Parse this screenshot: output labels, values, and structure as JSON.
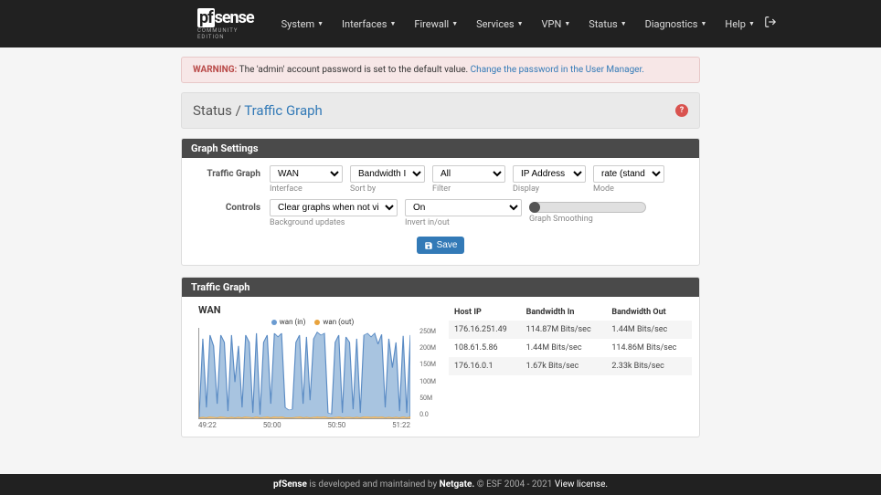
{
  "nav": {
    "items": [
      "System",
      "Interfaces",
      "Firewall",
      "Services",
      "VPN",
      "Status",
      "Diagnostics",
      "Help"
    ]
  },
  "alert": {
    "prefix": "WARNING:",
    "text": " The 'admin' account password is set to the default value. ",
    "link": "Change the password in the User Manager."
  },
  "breadcrumb": {
    "root": "Status",
    "sep": " / ",
    "page": "Traffic Graph"
  },
  "panel1": {
    "title": "Graph Settings",
    "row1_label": "Traffic Graph",
    "row2_label": "Controls",
    "interface": {
      "value": "WAN",
      "hint": "Interface"
    },
    "sort": {
      "value": "Bandwidth In",
      "hint": "Sort by"
    },
    "filter": {
      "value": "All",
      "hint": "Filter"
    },
    "display": {
      "value": "IP Address",
      "hint": "Display"
    },
    "mode": {
      "value": "rate (standard)",
      "hint": "Mode"
    },
    "bg": {
      "value": "Clear graphs when not visible.",
      "hint": "Background updates"
    },
    "invert": {
      "value": "On",
      "hint": "Invert in/out"
    },
    "smooth": {
      "hint": "Graph Smoothing"
    },
    "save": "Save"
  },
  "panel2": {
    "title": "Traffic Graph"
  },
  "chart_data": {
    "type": "area",
    "title": "WAN",
    "legend": [
      "wan (in)",
      "wan (out)"
    ],
    "ylim": [
      0,
      250000000
    ],
    "yticks": [
      "250M",
      "200M",
      "150M",
      "100M",
      "50M",
      "0.0"
    ],
    "xticks": [
      "49:22",
      "50:00",
      "50:50",
      "51:22"
    ],
    "series": [
      {
        "name": "wan (in)",
        "color": "#6b9bd1",
        "values": [
          10,
          220,
          30,
          230,
          200,
          40,
          230,
          210,
          20,
          230,
          100,
          200,
          30,
          230,
          210,
          15,
          235,
          10,
          210,
          230,
          40,
          235,
          225,
          235,
          30,
          23,
          25,
          210,
          230,
          40,
          225,
          50,
          220,
          238,
          230,
          235,
          15,
          12,
          210,
          230,
          15,
          225,
          210,
          25,
          220,
          15,
          230,
          235,
          225,
          235,
          205,
          232,
          30,
          220,
          140,
          210,
          20,
          228,
          15,
          230
        ]
      },
      {
        "name": "wan (out)",
        "color": "#e8a33d",
        "values": [
          2,
          3,
          2,
          4,
          3,
          2,
          4,
          3,
          2,
          3,
          2,
          3,
          2,
          4,
          3,
          2,
          4,
          2,
          3,
          4,
          2,
          4,
          3,
          4,
          2,
          2,
          2,
          3,
          4,
          2,
          3,
          2,
          3,
          4,
          3,
          4,
          2,
          2,
          3,
          4,
          2,
          3,
          3,
          2,
          3,
          2,
          4,
          4,
          3,
          4,
          3,
          4,
          2,
          3,
          2,
          3,
          2,
          4,
          2,
          4
        ]
      }
    ]
  },
  "table": {
    "headers": [
      "Host IP",
      "Bandwidth In",
      "Bandwidth Out"
    ],
    "rows": [
      [
        "176.16.251.49",
        "114.87M Bits/sec",
        "1.44M Bits/sec"
      ],
      [
        "108.61.5.86",
        "1.44M Bits/sec",
        "114.86M Bits/sec"
      ],
      [
        "176.16.0.1",
        "1.67k Bits/sec",
        "2.33k Bits/sec"
      ]
    ]
  },
  "footer": {
    "a": "pfSense",
    "b": " is developed and maintained by ",
    "c": "Netgate.",
    "d": " © ESF 2004 - 2021 ",
    "e": "View license."
  }
}
